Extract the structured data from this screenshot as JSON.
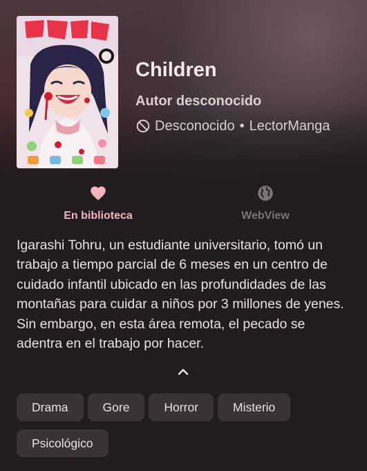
{
  "manga": {
    "title": "Children",
    "author": "Autor desconocido",
    "status": "Desconocido",
    "separator": "•",
    "source": "LectorManga"
  },
  "actions": {
    "library_label": "En biblioteca",
    "webview_label": "WebView"
  },
  "description": "Igarashi Tohru, un estudiante universitario, tomó un trabajo a tiempo parcial de 6 meses en un centro de cuidado infantil ubicado en las profundidades de las montañas para cuidar a niños por 3 millones de yenes. Sin embargo, en esta área remota, el pecado se adentra en el trabajo por hacer.",
  "genres": [
    "Drama",
    "Gore",
    "Horror",
    "Misterio",
    "Psicológico"
  ],
  "icons": {
    "favorite": "heart-icon",
    "webview": "globe-icon",
    "status": "block-icon",
    "collapse": "chevron-up-icon"
  },
  "colors": {
    "background": "#211c1d",
    "accent": "#f4b5bf",
    "muted": "#7d7374",
    "chip": "#3a3233",
    "text": "#ece0e1"
  }
}
